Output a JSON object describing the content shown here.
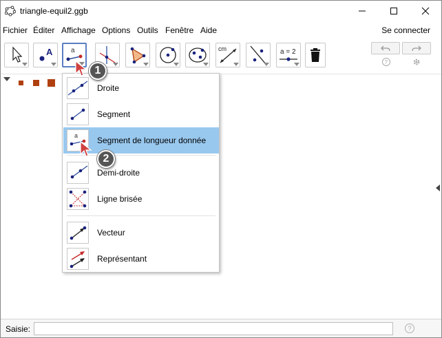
{
  "window": {
    "title": "triangle-equil2.ggb",
    "controls": [
      "minimize",
      "maximize",
      "close"
    ]
  },
  "menu": {
    "items": [
      "Fichier",
      "Éditer",
      "Affichage",
      "Options",
      "Outils",
      "Fenêtre",
      "Aide"
    ],
    "connect_label": "Se connecter"
  },
  "toolbar": {
    "tools": [
      {
        "name": "move-tool",
        "icon": "arrow-cursor-icon"
      },
      {
        "name": "point-tool",
        "icon": "point-a-icon",
        "glyph": "A"
      },
      {
        "name": "line-tool",
        "icon": "segment-fixed-length-icon",
        "glyph": "a",
        "active": true
      },
      {
        "name": "perpendicular-tool",
        "icon": "perpendicular-line-icon"
      },
      {
        "name": "polygon-tool",
        "icon": "polygon-icon"
      },
      {
        "name": "circle-tool",
        "icon": "circle-center-point-icon"
      },
      {
        "name": "conic-tool",
        "icon": "ellipse-icon"
      },
      {
        "name": "measure-tool",
        "icon": "distance-measure-icon",
        "glyph": "cm"
      },
      {
        "name": "reflect-tool",
        "icon": "reflect-line-icon"
      },
      {
        "name": "slider-tool",
        "icon": "slider-icon",
        "glyph": "a = 2"
      },
      {
        "name": "delete-tool",
        "icon": "trash-icon"
      }
    ],
    "undo_icon": "undo-icon",
    "redo_icon": "redo-icon",
    "help_icon": "help-icon",
    "settings_icon": "gear-icon",
    "help_glyph": "?"
  },
  "stylebar": {
    "colors": [
      "#b04010",
      "#b04010",
      "#b04010"
    ]
  },
  "dropdown": {
    "items": [
      {
        "label": "Droite",
        "icon": "line-through-two-points-icon"
      },
      {
        "label": "Segment",
        "icon": "segment-icon"
      },
      {
        "label": "Segment de longueur donnée",
        "icon": "segment-fixed-length-icon",
        "highlighted": true
      },
      {
        "label": "Demi-droite",
        "icon": "ray-icon"
      },
      {
        "label": "Ligne brisée",
        "icon": "polyline-icon"
      },
      {
        "label": "Vecteur",
        "icon": "vector-icon"
      },
      {
        "label": "Représentant",
        "icon": "vector-from-point-icon"
      }
    ],
    "highlight_color": "#99c8ee"
  },
  "annotations": {
    "step1": "1",
    "step2": "2"
  },
  "inputbar": {
    "label": "Saisie:",
    "value": "",
    "help_glyph": "?"
  },
  "colors": {
    "point_blue": "#1a237e",
    "point_red": "#c62828",
    "line_blue": "#2e4e9e",
    "selection": "#99c8ee"
  }
}
